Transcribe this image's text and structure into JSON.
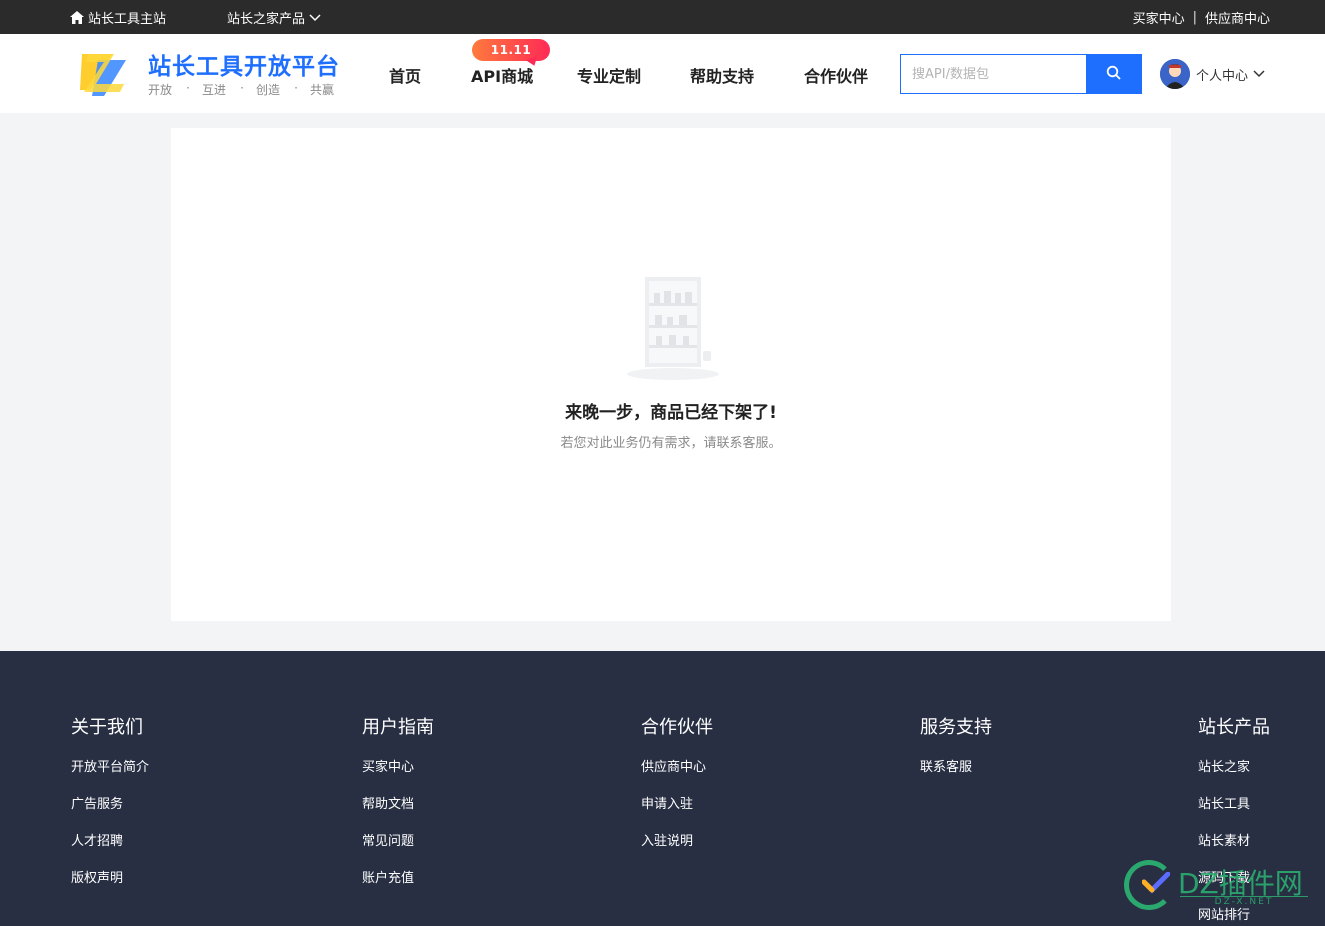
{
  "topbar": {
    "home_label": "站长工具主站",
    "products_label": "站长之家产品",
    "buyer_center": "买家中心",
    "separator": "|",
    "supplier_center": "供应商中心"
  },
  "header": {
    "logo_title": "站长工具开放平台",
    "logo_sub": [
      "开放",
      "互进",
      "创造",
      "共赢"
    ],
    "logo_dot": "·",
    "nav": [
      "首页",
      "API商城",
      "专业定制",
      "帮助支持",
      "合作伙伴"
    ],
    "promo_badge": "11.11",
    "search_placeholder": "搜API/数据包",
    "user_label": "个人中心"
  },
  "main": {
    "empty_title": "来晚一步，商品已经下架了!",
    "empty_subtitle": "若您对此业务仍有需求，请联系客服。"
  },
  "footer": {
    "columns": [
      {
        "title": "关于我们",
        "links": [
          "开放平台简介",
          "广告服务",
          "人才招聘",
          "版权声明"
        ]
      },
      {
        "title": "用户指南",
        "links": [
          "买家中心",
          "帮助文档",
          "常见问题",
          "账户充值"
        ]
      },
      {
        "title": "合作伙伴",
        "links": [
          "供应商中心",
          "申请入驻",
          "入驻说明"
        ]
      },
      {
        "title": "服务支持",
        "links": [
          "联系客服"
        ]
      },
      {
        "title": "站长产品",
        "links": [
          "站长之家",
          "站长工具",
          "站长素材",
          "源码下载",
          "网站排行"
        ]
      }
    ]
  },
  "watermark": {
    "text": "DZ插件网",
    "sub": "DZ-X.NET"
  },
  "colors": {
    "accent": "#1f6fff",
    "topbar_bg": "#2b2b2b",
    "footer_bg": "#282f43",
    "page_bg": "#f3f4f6",
    "promo_gradient": [
      "#ff7a3d",
      "#ff2a55"
    ],
    "watermark": "#2bb673"
  },
  "icons": {
    "home": "home-icon",
    "chevron": "chevron-down-icon",
    "search": "search-icon",
    "avatar": "user-avatar-icon",
    "empty": "empty-shelf-icon"
  }
}
